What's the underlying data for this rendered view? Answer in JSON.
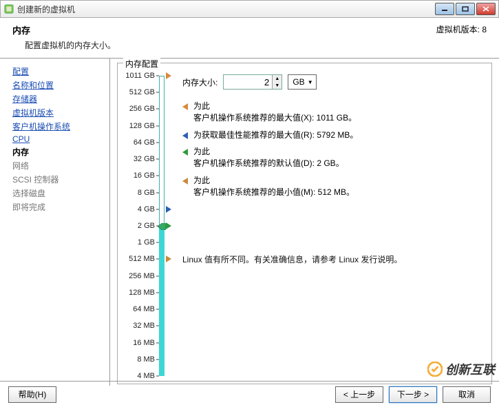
{
  "titlebar": {
    "title": "创建新的虚拟机"
  },
  "header": {
    "title": "内存",
    "subtitle": "配置虚拟机的内存大小。",
    "version_label": "虚拟机版本: 8"
  },
  "sidebar": {
    "items": [
      {
        "label": "配置",
        "state": "link"
      },
      {
        "label": "名称和位置",
        "state": "link"
      },
      {
        "label": "存储器",
        "state": "link"
      },
      {
        "label": "虚拟机版本",
        "state": "link"
      },
      {
        "label": "客户机操作系统",
        "state": "link"
      },
      {
        "label": "CPU",
        "state": "link"
      },
      {
        "label": "内存",
        "state": "current"
      },
      {
        "label": "网络",
        "state": "disabled"
      },
      {
        "label": "SCSI 控制器",
        "state": "disabled"
      },
      {
        "label": "选择磁盘",
        "state": "disabled"
      },
      {
        "label": "即将完成",
        "state": "disabled"
      }
    ]
  },
  "memory": {
    "group_title": "内存配置",
    "size_label": "内存大小:",
    "size_value": "2",
    "unit": "GB",
    "ticks": [
      "1011 GB",
      "512 GB",
      "256 GB",
      "128 GB",
      "64 GB",
      "32 GB",
      "16 GB",
      "8 GB",
      "4 GB",
      "2 GB",
      "1 GB",
      "512 MB",
      "256 MB",
      "128 MB",
      "64 MB",
      "32 MB",
      "16 MB",
      "8 MB",
      "4 MB"
    ],
    "slider_fill_from_tick": 9,
    "markers": [
      {
        "color": "#d98a3e",
        "tick": 0
      },
      {
        "color": "#2b5fb3",
        "tick": 8
      },
      {
        "color": "#2e9a3e",
        "tick": 9
      },
      {
        "color": "#c98a3e",
        "tick": 11
      }
    ],
    "recommendations": [
      {
        "color": "#d98a3e",
        "line1": "为此",
        "line2_prefix": "客户机操作系统推荐的最大值(X): ",
        "value": "1011 GB",
        "suffix": "。"
      },
      {
        "color": "#2b5fb3",
        "line1": "",
        "line2_prefix": "为获取最佳性能推荐的最大值(R): ",
        "value": "5792 MB",
        "suffix": "。"
      },
      {
        "color": "#2e9a3e",
        "line1": "为此",
        "line2_prefix": "客户机操作系统推荐的默认值(D): ",
        "value": "2 GB",
        "suffix": "。"
      },
      {
        "color": "#c98a3e",
        "line1": "为此",
        "line2_prefix": "客户机操作系统推荐的最小值(M): ",
        "value": "512 MB",
        "suffix": "。"
      }
    ],
    "note": "Linux 值有所不同。有关准确信息，请参考 Linux 发行说明。"
  },
  "footer": {
    "help": "帮助(H)",
    "back": "< 上一步",
    "next": "下一步 >",
    "cancel": "取消"
  },
  "watermark": {
    "text": "创新互联"
  }
}
